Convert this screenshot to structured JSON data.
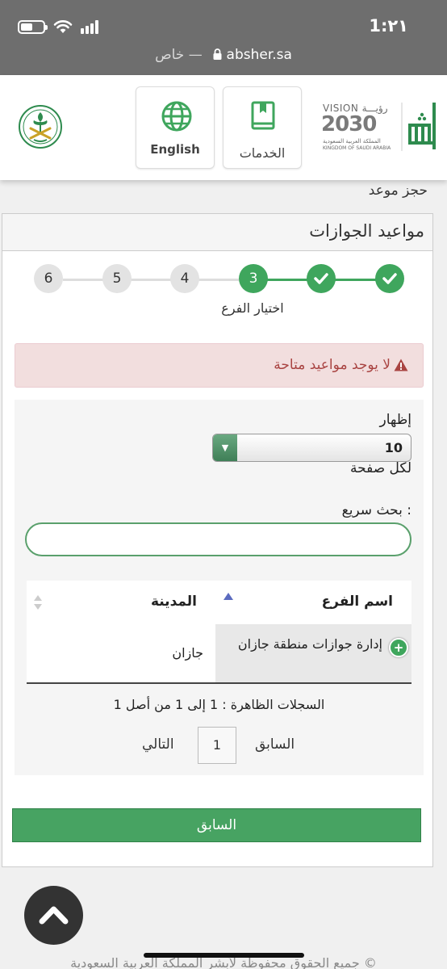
{
  "status_bar": {
    "time": "1:٢١",
    "url_private": "خاص —",
    "url_host": "absher.sa",
    "battery_level": 0.55
  },
  "header": {
    "english_label": "English",
    "services_label": "الخدمات",
    "vision": {
      "word": "VISION رؤيـــة",
      "year": "2030",
      "arabic": "المملكة العربية السعودية",
      "english": "KINGDOM OF SAUDI ARABIA"
    },
    "colors": {
      "green": "#3fa65d",
      "gray": "#7a7a7a"
    }
  },
  "page": {
    "breadcrumb": "حجز موعد",
    "title": "مواعيد الجوازات",
    "steps": [
      {
        "label": "",
        "state": "done"
      },
      {
        "label": "",
        "state": "done"
      },
      {
        "label": "3",
        "state": "current"
      },
      {
        "label": "4",
        "state": "todo"
      },
      {
        "label": "5",
        "state": "todo"
      },
      {
        "label": "6",
        "state": "todo"
      }
    ],
    "current_step_label": "اختيار الفرع",
    "alert_text": "لا يوجد مواعيد متاحة",
    "alert_icon": "warning-icon",
    "show_label": "إظهار",
    "page_size": "10",
    "per_page_label": "لكل صفحة",
    "search_label": "بحث سريع :",
    "search_value": "",
    "table": {
      "columns": [
        "اسم الفرع",
        "المدينة"
      ],
      "rows": [
        {
          "branch": "إدارة جوازات منطقة جازان",
          "city": "جازان"
        }
      ]
    },
    "records_text": "السجلات الظاهرة : 1 إلى 1 من أصل 1",
    "pager": {
      "prev": "السابق",
      "page": "1",
      "next": "التالي"
    },
    "back_button": "السابق",
    "footer": "جميع الحقوق محفوظة لأبشر المملكة العربية السعودية ©"
  }
}
